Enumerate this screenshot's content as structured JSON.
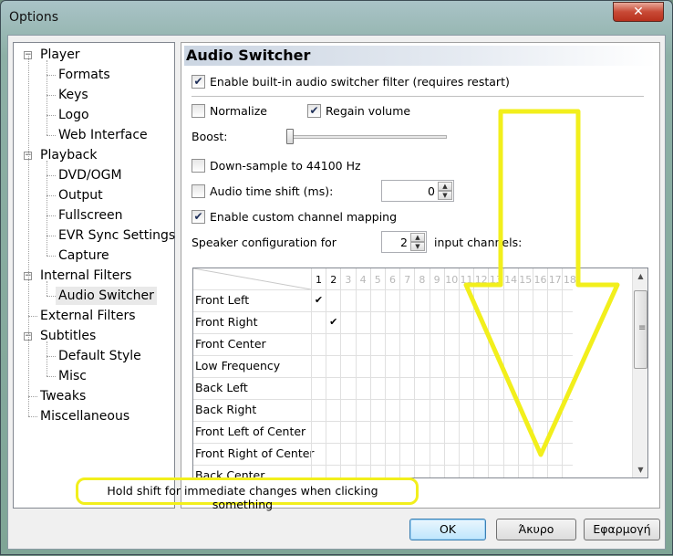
{
  "window": {
    "title": "Options",
    "close_glyph": "✕"
  },
  "tree": {
    "items": [
      {
        "label": "Player",
        "level": 0,
        "toggle": "−"
      },
      {
        "label": "Formats",
        "level": 1
      },
      {
        "label": "Keys",
        "level": 1
      },
      {
        "label": "Logo",
        "level": 1
      },
      {
        "label": "Web Interface",
        "level": 1
      },
      {
        "label": "Playback",
        "level": 0,
        "toggle": "−"
      },
      {
        "label": "DVD/OGM",
        "level": 1
      },
      {
        "label": "Output",
        "level": 1
      },
      {
        "label": "Fullscreen",
        "level": 1
      },
      {
        "label": "EVR Sync Settings",
        "level": 1
      },
      {
        "label": "Capture",
        "level": 1
      },
      {
        "label": "Internal Filters",
        "level": 0,
        "toggle": "−"
      },
      {
        "label": "Audio Switcher",
        "level": 1,
        "selected": true
      },
      {
        "label": "External Filters",
        "level": 0
      },
      {
        "label": "Subtitles",
        "level": 0,
        "toggle": "−"
      },
      {
        "label": "Default Style",
        "level": 1
      },
      {
        "label": "Misc",
        "level": 1
      },
      {
        "label": "Tweaks",
        "level": 0
      },
      {
        "label": "Miscellaneous",
        "level": 0
      }
    ]
  },
  "panel": {
    "title": "Audio Switcher",
    "enable_filter": {
      "label": "Enable built-in audio switcher filter (requires restart)",
      "checked": true
    },
    "normalize": {
      "label": "Normalize",
      "checked": false
    },
    "regain": {
      "label": "Regain volume",
      "checked": true
    },
    "boost": {
      "label": "Boost:",
      "level_percent": 0
    },
    "downsample": {
      "label": "Down-sample to 44100 Hz",
      "checked": false
    },
    "time_shift": {
      "label": "Audio time shift (ms):",
      "checked": false,
      "value": "0"
    },
    "custom_mapping": {
      "label": "Enable custom channel mapping",
      "checked": true
    },
    "speaker_config": {
      "label_before": "Speaker configuration for",
      "value": "2",
      "label_after": "input channels:"
    },
    "check_glyph": "✔",
    "spin_up": "▲",
    "spin_down": "▼"
  },
  "channel_grid": {
    "columns": [
      "1",
      "2",
      "3",
      "4",
      "5",
      "6",
      "7",
      "8",
      "9",
      "10",
      "11",
      "12",
      "13",
      "14",
      "15",
      "16",
      "17",
      "18"
    ],
    "active_columns": 2,
    "rows": [
      {
        "label": "Front Left",
        "checked_col": 1
      },
      {
        "label": "Front Right",
        "checked_col": 2
      },
      {
        "label": "Front Center",
        "checked_col": 0
      },
      {
        "label": "Low Frequency",
        "checked_col": 0
      },
      {
        "label": "Back Left",
        "checked_col": 0
      },
      {
        "label": "Back Right",
        "checked_col": 0
      },
      {
        "label": "Front Left of Center",
        "checked_col": 0
      },
      {
        "label": "Front Right of Center",
        "checked_col": 0
      },
      {
        "label": "Back Center",
        "checked_col": 0
      }
    ],
    "scroll_up": "▲",
    "scroll_down": "▼",
    "grip": "≡"
  },
  "hint": "Hold shift for immediate changes when clicking something",
  "buttons": {
    "ok": "OK",
    "cancel": "Άκυρο",
    "apply": "Εφαρμογή"
  },
  "colors": {
    "annotation": "#f2ef1c",
    "selection": "#e9e9e9"
  }
}
